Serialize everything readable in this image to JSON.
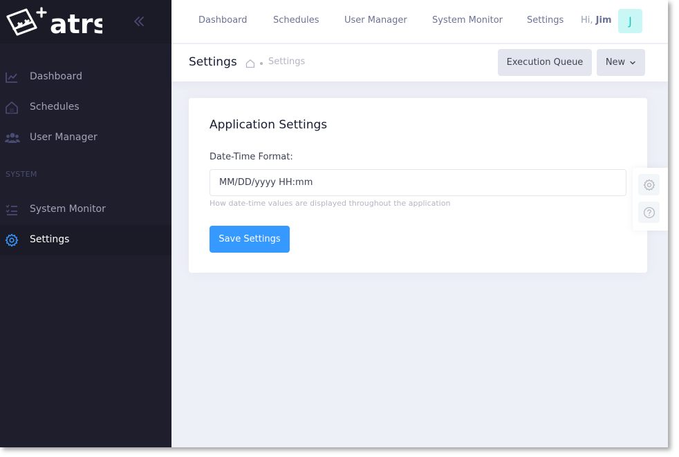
{
  "brand": {
    "logo_text": "atrs"
  },
  "sidebar": {
    "items": [
      {
        "label": "Dashboard",
        "icon": "chart-line-icon"
      },
      {
        "label": "Schedules",
        "icon": "home-icon"
      },
      {
        "label": "User Manager",
        "icon": "users-icon"
      }
    ],
    "section_label": "SYSTEM",
    "system_items": [
      {
        "label": "System Monitor",
        "icon": "list-check-icon"
      },
      {
        "label": "Settings",
        "icon": "gear-icon",
        "active": true
      }
    ]
  },
  "header": {
    "nav": [
      "Dashboard",
      "Schedules",
      "User Manager",
      "System Monitor",
      "Settings"
    ],
    "greeting": "Hi,",
    "user_name": "Jim",
    "avatar_letter": "J"
  },
  "subheader": {
    "title": "Settings",
    "breadcrumb": "Settings",
    "execution_queue_label": "Execution Queue",
    "new_label": "New"
  },
  "card": {
    "title": "Application Settings",
    "field_label": "Date-Time Format:",
    "field_value": "MM/DD/yyyy HH:mm",
    "field_help": "How date-time values are displayed throughout the application",
    "save_label": "Save Settings"
  },
  "colors": {
    "sidebar_bg": "#1e1e2d",
    "accent": "#3699ff",
    "avatar_bg": "#c9f7f5",
    "avatar_text": "#1bc5bd"
  }
}
